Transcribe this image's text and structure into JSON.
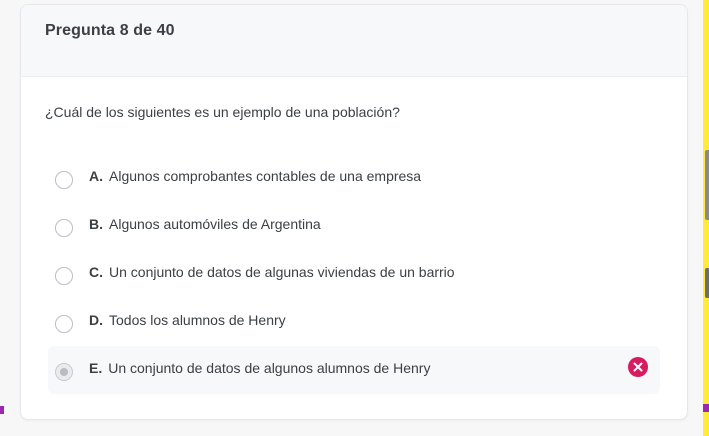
{
  "header": {
    "counter": "Pregunta 8 de 40"
  },
  "question": {
    "text": "¿Cuál de los siguientes es un ejemplo de una población?"
  },
  "options": [
    {
      "letter": "A.",
      "text": "Algunos comprobantes contables de una empresa",
      "selected": false
    },
    {
      "letter": "B.",
      "text": "Algunos automóviles de Argentina",
      "selected": false
    },
    {
      "letter": "C.",
      "text": "Un conjunto de datos de algunas viviendas de un barrio",
      "selected": false
    },
    {
      "letter": "D.",
      "text": "Todos los alumnos de Henry",
      "selected": false
    },
    {
      "letter": "E.",
      "text": "Un conjunto de datos de algunos alumnos de Henry",
      "selected": true,
      "result": "incorrect"
    }
  ],
  "colors": {
    "incorrect": "#d81b60",
    "accent_edge": "#ffeb3b",
    "edge_marker": "#9c27b0"
  },
  "icons": {
    "result_icon": "close-circle-icon"
  }
}
